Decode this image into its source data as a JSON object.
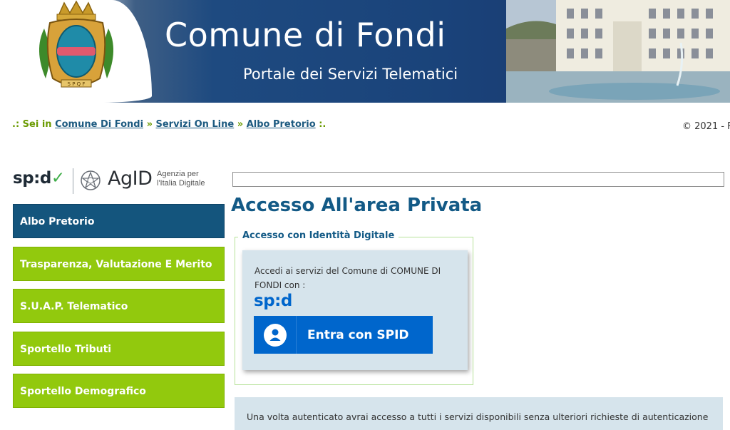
{
  "banner": {
    "title": "Comune di Fondi",
    "subtitle": "Portale dei Servizi Telematici"
  },
  "breadcrumb": {
    "prefix": ".: Sei in",
    "items": [
      "Comune Di Fondi",
      "Servizi On Line",
      "Albo Pretorio"
    ],
    "separator": "»",
    "suffix": ":."
  },
  "copyright": "© 2021 - F",
  "logos": {
    "spid": "sp:d",
    "agid": "AgID",
    "agid_line1": "Agenzia per",
    "agid_line2": "l'Italia Digitale"
  },
  "sidebar": {
    "items": [
      {
        "label": "Albo Pretorio",
        "active": true
      },
      {
        "label": "Trasparenza, Valutazione E Merito",
        "active": false
      },
      {
        "label": "S.U.A.P. Telematico",
        "active": false
      },
      {
        "label": "Sportello Tributi",
        "active": false
      },
      {
        "label": "Sportello Demografico",
        "active": false
      }
    ]
  },
  "main": {
    "title": "Accesso All'area Privata",
    "fieldset_legend": "Accesso con Identità Digitale",
    "card_text": "Accedi ai servizi del Comune di COMUNE DI FONDI con :",
    "spid_logo": "sp:d",
    "spid_button_label": "Entra con SPID",
    "info_text": "Una volta autenticato avrai accesso a tutti i servizi disponibili senza ulteriori richieste di autenticazione"
  },
  "colors": {
    "nav_green": "#92c90d",
    "nav_active": "#14557d",
    "spid_blue": "#0066cc",
    "title_blue": "#135a86",
    "card_bg": "#d6e4ec"
  }
}
